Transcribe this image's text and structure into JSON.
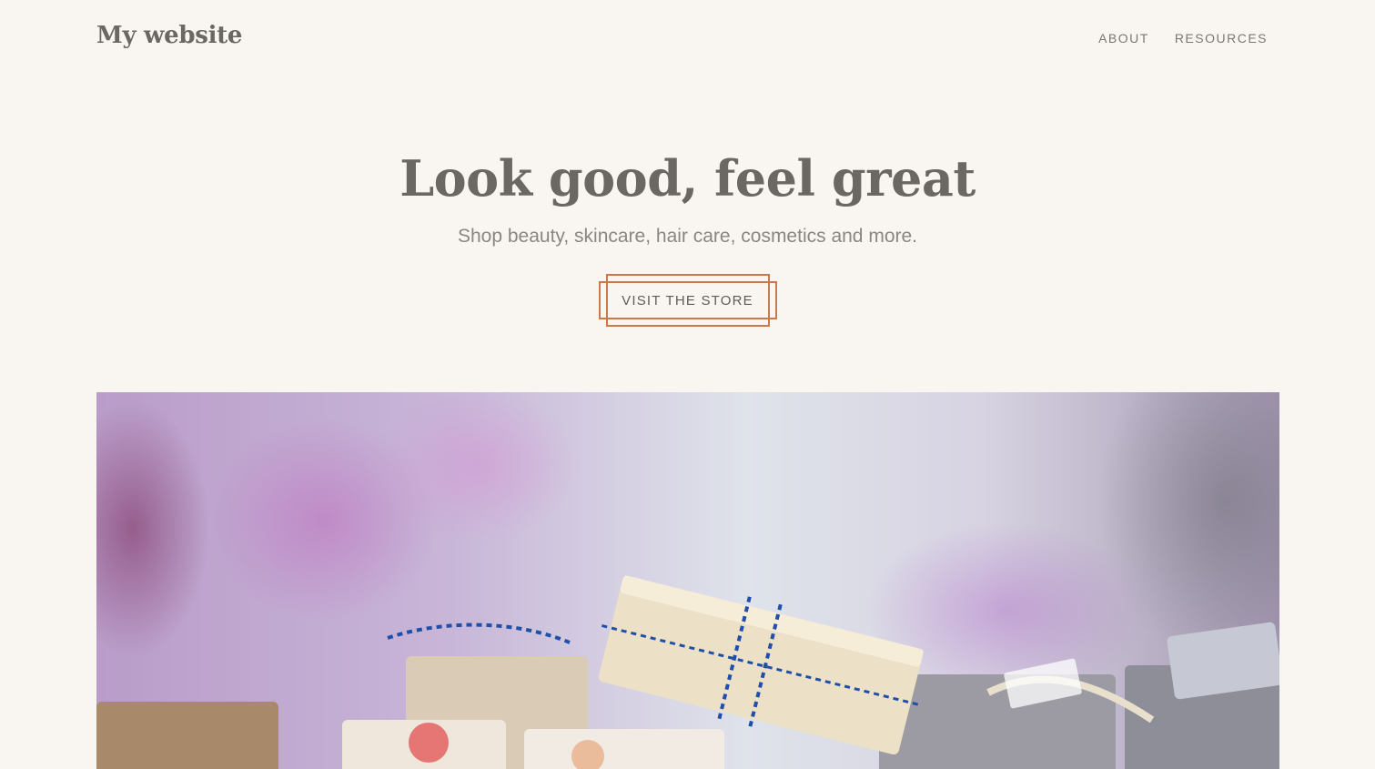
{
  "header": {
    "site_title": "My website",
    "nav": [
      {
        "label": "ABOUT"
      },
      {
        "label": "RESOURCES"
      }
    ]
  },
  "hero": {
    "title": "Look good, feel great",
    "subtitle": "Shop beauty, skincare, hair care, cosmetics and more.",
    "cta_label": "VISIT THE STORE"
  },
  "colors": {
    "background": "#f9f5f1",
    "text": "#6b6863",
    "accent_border": "#c87a4f"
  }
}
